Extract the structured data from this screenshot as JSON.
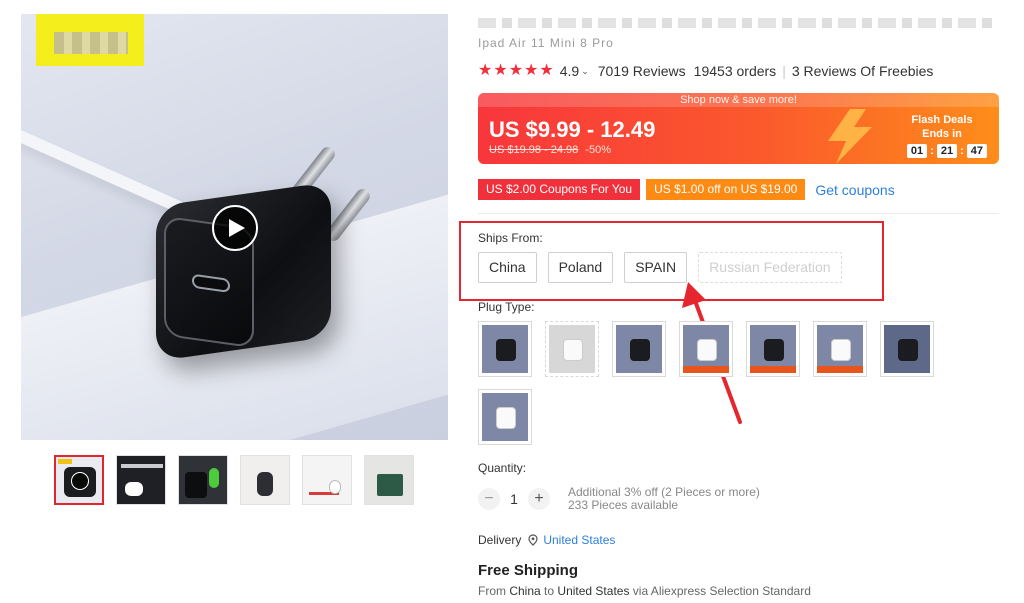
{
  "product": {
    "title_line2": "Ipad Air 11 Mini 8 Pro",
    "rating": "4.9",
    "reviews": "7019 Reviews",
    "orders": "19453 orders",
    "freebies": "3 Reviews Of Freebies"
  },
  "price": {
    "promo": "Shop now & save more!",
    "current": "US $9.99 - 12.49",
    "original": "US $19.98 - 24.98",
    "discount": "-50%",
    "flash_title": "Flash Deals",
    "ends_in": "Ends in",
    "timer": [
      "01",
      "21",
      "47"
    ]
  },
  "coupons": {
    "c1": "US $2.00 Coupons For You",
    "c2": "US $1.00 off on US $19.00",
    "get": "Get coupons"
  },
  "ships_from": {
    "label": "Ships From:",
    "options": [
      "China",
      "Poland",
      "SPAIN",
      "Russian Federation"
    ]
  },
  "plug": {
    "label": "Plug Type:"
  },
  "quantity": {
    "label": "Quantity:",
    "value": "1",
    "minus": "−",
    "plus": "+",
    "discount": "Additional 3% off (2 Pieces or more)",
    "available": "233 Pieces available"
  },
  "delivery": {
    "label": "Delivery",
    "country": "United States"
  },
  "shipping": {
    "title": "Free Shipping",
    "from_word": "From",
    "from": "China",
    "to_word": "to",
    "to": "United States",
    "via": "via Aliexpress Selection Standard"
  },
  "colors": {
    "accent": "#f0303a",
    "highlight": "#e5262f",
    "link": "#2d7fdb",
    "orange": "#fc8a13"
  },
  "icons": [
    "play-icon",
    "star-icon",
    "caret-down-icon",
    "lightning-icon",
    "location-pin-icon",
    "annotation-arrow-icon"
  ]
}
